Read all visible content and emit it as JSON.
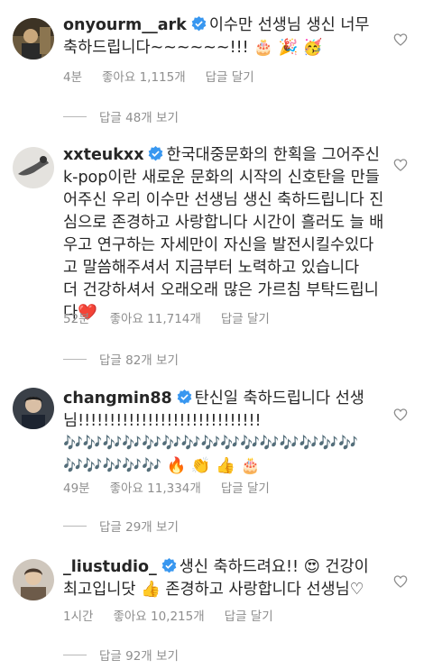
{
  "comments": [
    {
      "username": "onyourm__ark",
      "text": "이수만 선생님 생신 너무 축하드립니다~~~~~~!!! 🎂 🎉 🥳",
      "time": "4분",
      "likes": "좋아요 1,115개",
      "reply_action": "답글 달기",
      "view_replies": "답글 48개 보기"
    },
    {
      "username": "xxteukxx",
      "text": "한국대중문화의 한획을 그어주신 k-pop이란 새로운 문화의 시작의 신호탄을 만들어주신 우리 이수만 선생님 생신 축하드립니다 진심으로 존경하고 사랑합니다 시간이 흘러도 늘 배우고 연구하는 자세만이 자신을 발전시킬수있다고 말씀해주셔서 지금부터 노력하고 있습니다",
      "text2": "더 건강하셔서 오래오래 많은 가르침 부탁드립니다",
      "heart": "❤️",
      "time": "52분",
      "likes": "좋아요 11,714개",
      "reply_action": "답글 달기",
      "view_replies": "답글 82개 보기"
    },
    {
      "username": "changmin88",
      "text": "탄신일 축하드립니다 선생님!!!!!!!!!!!!!!!!!!!!!!!!!!!!!",
      "emojis": "🎶🎶🎶🎶🎶🎶🎶🎶🎶🎶🎶🎶🎶🎶🎶🎶🎶🎶🎶🎶 🔥 👏 👍 🎂",
      "time": "49분",
      "likes": "좋아요 11,334개",
      "reply_action": "답글 달기",
      "view_replies": "답글 29개 보기"
    },
    {
      "username": "_liustudio_",
      "text": "생신 축하드려요!! 😍 건강이 최고입니닷 👍 존경하고 사랑합니다 선생님♡",
      "time": "1시간",
      "likes": "좋아요 10,215개",
      "reply_action": "답글 달기",
      "view_replies": "답글 92개 보기"
    }
  ],
  "icons": {
    "verified": "verified-badge-icon",
    "like": "heart-outline-icon"
  },
  "colors": {
    "verified": "#3897f0",
    "meta": "#8e8e8e",
    "heart": "#e0192e"
  }
}
